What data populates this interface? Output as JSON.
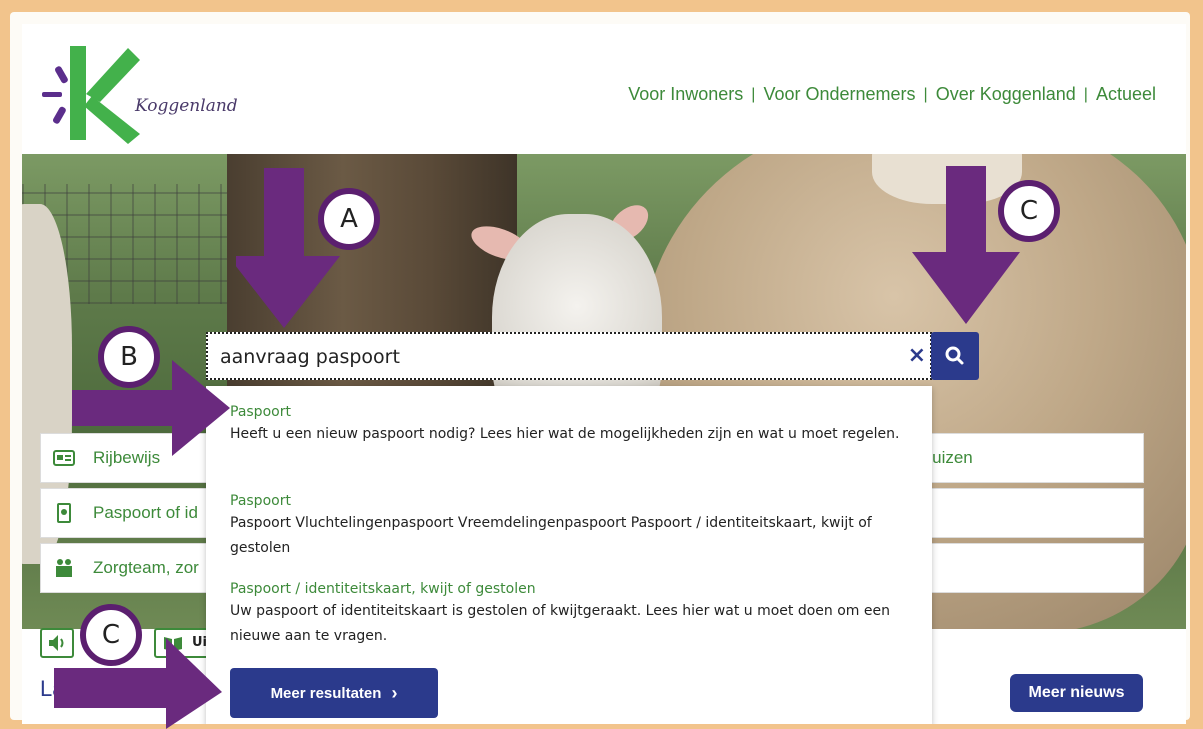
{
  "header": {
    "logo_text": "Koggenland",
    "nav": [
      "Voor Inwoners",
      "Voor Ondernemers",
      "Over Koggenland",
      "Actueel"
    ],
    "nav_sep": "|"
  },
  "search": {
    "value": "aanvraag paspoort",
    "clear_icon": "×"
  },
  "quick_links": [
    {
      "label": "Rijbewijs",
      "right_label": "rhuizen"
    },
    {
      "label": "Paspoort of id",
      "right_label": ""
    },
    {
      "label": "Zorgteam, zor",
      "right_label": ""
    }
  ],
  "suggestions": [
    {
      "title": "Paspoort",
      "desc": "Heeft u een nieuw paspoort nodig? Lees hier wat de mogelijkheden zijn en wat u moet regelen."
    },
    {
      "title": "Paspoort",
      "desc": "Paspoort Vluchtelingenpaspoort Vreemdelingenpaspoort Paspoort / identiteitskaart, kwijt of gestolen"
    },
    {
      "title": "Paspoort / identiteitskaart, kwijt of gestolen",
      "desc": "Uw paspoort of identiteitskaart is gestolen of kwijtgeraakt. Lees hier wat u moet doen om een nieuwe aan te vragen."
    }
  ],
  "more_results": "Meer resultaten",
  "more_results_chevron": "›",
  "toolbar": {
    "read_label": "Ui"
  },
  "section_title": "La",
  "news_button": "Meer nieuws",
  "annotations": {
    "a": "A",
    "b": "B",
    "c_top": "C",
    "c_bottom": "C"
  },
  "colors": {
    "brand_green": "#3d8a3a",
    "brand_blue": "#2b3a8c",
    "annotation_purple": "#5b1f6f",
    "frame": "#f2c48c"
  }
}
